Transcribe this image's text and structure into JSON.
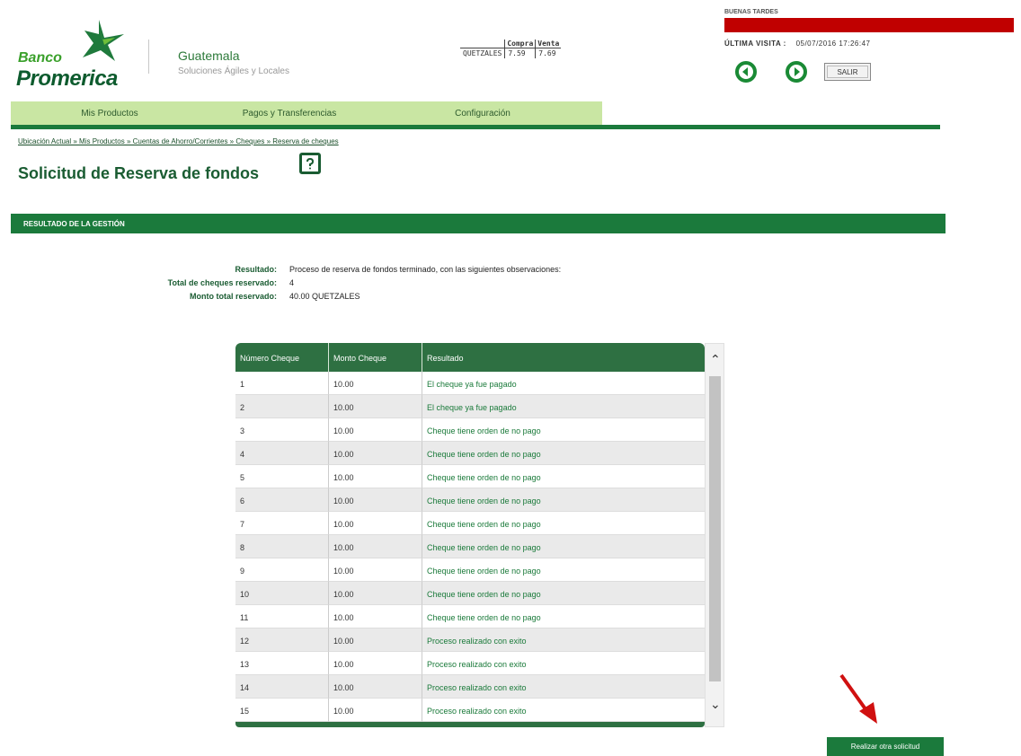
{
  "brand": {
    "banco": "Banco",
    "promerica": "Promerica",
    "country": "Guatemala",
    "tagline": "Soluciones Ágiles y Locales",
    "colors": {
      "primary_green": "#1b7a3c",
      "light_green": "#c9e6a3",
      "alert_red": "#c00000",
      "arrow_red": "#d01010"
    }
  },
  "rates": {
    "headers": [
      "Compra",
      "Venta"
    ],
    "currency": "QUETZALES",
    "buy": "7.59",
    "sell": "7.69"
  },
  "user": {
    "greeting": "BUENAS TARDES",
    "last_visit_label": "ÚLTIMA VISITA :",
    "last_visit_value": "05/07/2016 17:26:47",
    "salir_label": "SALIR"
  },
  "nav_icons": {
    "back": "back-arrow-icon",
    "forward": "forward-arrow-icon"
  },
  "menu": [
    {
      "label": "Mis Productos"
    },
    {
      "label": "Pagos y Transferencias"
    },
    {
      "label": "Configuración"
    }
  ],
  "breadcrumb": "Ubicación Actual » Mis Productos » Cuentas de Ahorro/Corrientes » Cheques » Reserva de cheques",
  "page_title": "Solicitud de Reserva de fondos",
  "section_title": "RESULTADO DE LA GESTIÓN",
  "summary": [
    {
      "label": "Resultado:",
      "value": "Proceso de reserva de fondos terminado, con las siguientes observaciones:"
    },
    {
      "label": "Total de cheques reservado:",
      "value": "4"
    },
    {
      "label": "Monto total reservado:",
      "value": "40.00 QUETZALES"
    }
  ],
  "table": {
    "headers": [
      "Número Cheque",
      "Monto Cheque",
      "Resultado"
    ],
    "rows": [
      [
        "1",
        "10.00",
        "El cheque ya fue pagado"
      ],
      [
        "2",
        "10.00",
        "El cheque ya fue pagado"
      ],
      [
        "3",
        "10.00",
        "Cheque tiene orden de no pago"
      ],
      [
        "4",
        "10.00",
        "Cheque tiene orden de no pago"
      ],
      [
        "5",
        "10.00",
        "Cheque tiene orden de no pago"
      ],
      [
        "6",
        "10.00",
        "Cheque tiene orden de no pago"
      ],
      [
        "7",
        "10.00",
        "Cheque tiene orden de no pago"
      ],
      [
        "8",
        "10.00",
        "Cheque tiene orden de no pago"
      ],
      [
        "9",
        "10.00",
        "Cheque tiene orden de no pago"
      ],
      [
        "10",
        "10.00",
        "Cheque tiene orden de no pago"
      ],
      [
        "11",
        "10.00",
        "Cheque tiene orden de no pago"
      ],
      [
        "12",
        "10.00",
        "Proceso realizado con exito"
      ],
      [
        "13",
        "10.00",
        "Proceso realizado con exito"
      ],
      [
        "14",
        "10.00",
        "Proceso realizado con exito"
      ],
      [
        "15",
        "10.00",
        "Proceso realizado con exito"
      ]
    ]
  },
  "actions": {
    "new_request": "Realizar otra solicitud"
  }
}
